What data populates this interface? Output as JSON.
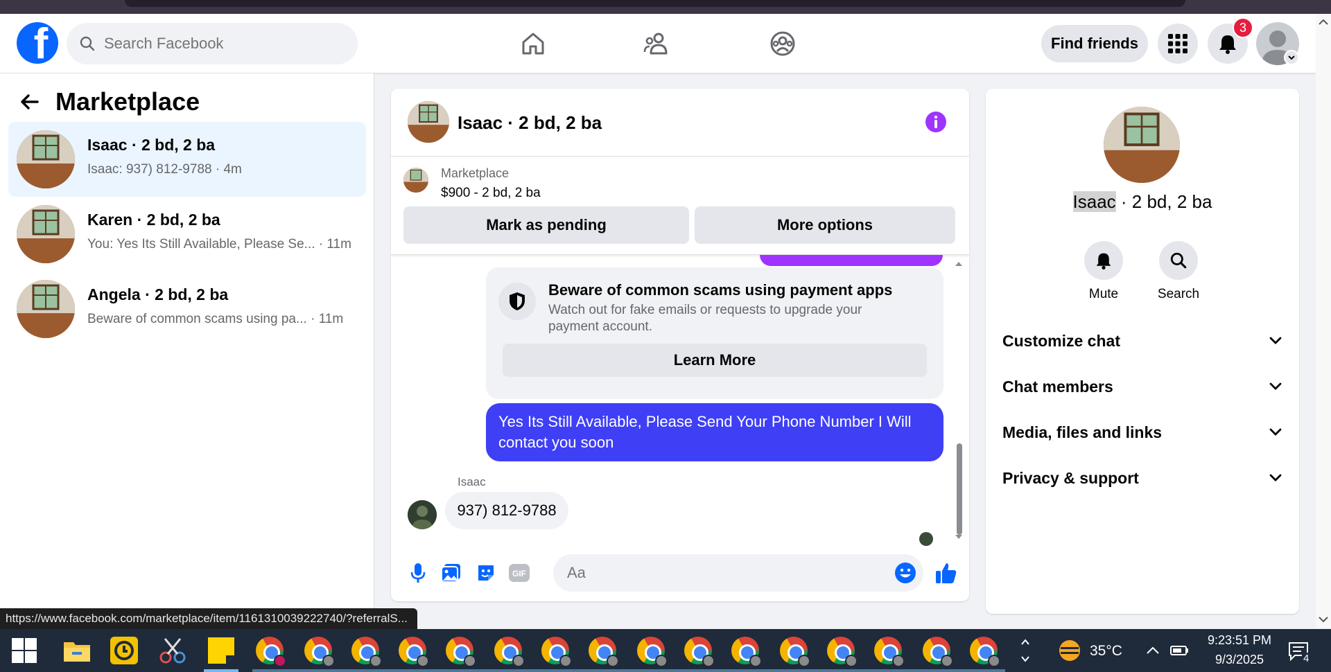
{
  "header": {
    "logo_letter": "f",
    "search_placeholder": "Search Facebook",
    "find_friends_label": "Find friends",
    "notification_count": "3"
  },
  "left": {
    "title": "Marketplace",
    "conversations": [
      {
        "name": "Isaac · 2 bd, 2 ba",
        "preview": "Isaac: 937) 812-9788 · 4m",
        "active": true
      },
      {
        "name": "Karen · 2 bd, 2 ba",
        "preview": "You: Yes Its Still Available, Please Se... · 11m",
        "active": false
      },
      {
        "name": "Angela · 2 bd, 2 ba",
        "preview": "Beware of common scams using pa... · 11m",
        "active": false
      }
    ]
  },
  "chat": {
    "title": "Isaac · 2 bd, 2 ba",
    "listing_source": "Marketplace",
    "listing_price": "$900 - 2 bd, 2 ba",
    "mark_pending_label": "Mark as pending",
    "more_options_label": "More options",
    "scam_title": "Beware of common scams using payment apps",
    "scam_body": "Watch out for fake emails or requests to upgrade your payment account.",
    "learn_more_label": "Learn More",
    "outgoing_message": "Yes Its Still Available, Please Send Your Phone Number I Will contact you soon",
    "sender_label": "Isaac",
    "incoming_message": "937) 812-9788",
    "composer_placeholder": "Aa"
  },
  "right": {
    "name_highlight": "Isaac",
    "name_rest": " · 2 bd, 2 ba",
    "mute_label": "Mute",
    "search_label": "Search",
    "sections": [
      "Customize chat",
      "Chat members",
      "Media, files and links",
      "Privacy & support"
    ]
  },
  "status_url": "https://www.facebook.com/marketplace/item/1161310039222740/?referralS...",
  "taskbar": {
    "weather": "35°C",
    "time": "9:23:51 PM",
    "date": "9/3/2025",
    "notification_count": "4"
  },
  "colors": {
    "brand": "#0866ff",
    "outgoing_bubble": "#3f3ff5",
    "info_icon": "#a033ff",
    "badge": "#e41e3f"
  }
}
